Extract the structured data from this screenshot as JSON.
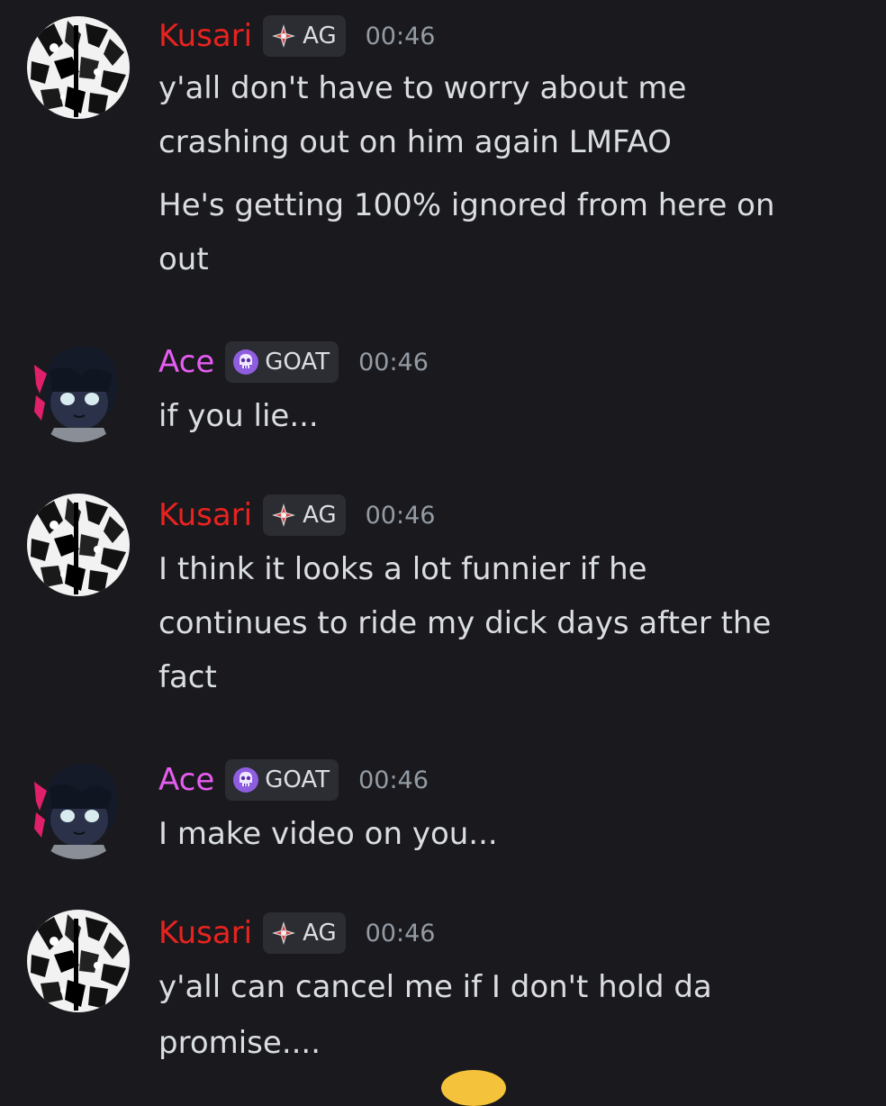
{
  "colors": {
    "background": "#1a1a1e",
    "kusari_name": "#e8231f",
    "ace_name": "#e75cf2",
    "message_text": "#dbdee1",
    "timestamp": "#949ba4",
    "tag_bg": "#2b2d33"
  },
  "messages": [
    {
      "author": "Kusari",
      "tag": "AG",
      "tag_icon": "crosshair-diamond-icon",
      "avatar": "kusari-avatar",
      "time": "00:46",
      "lines": [
        "y'all don't have to worry about me",
        "crashing out on him again LMFAO",
        "He's getting 100% ignored from here on",
        "out"
      ]
    },
    {
      "author": "Ace",
      "tag": "GOAT",
      "tag_icon": "skull-icon",
      "avatar": "ace-avatar",
      "time": "00:46",
      "lines": [
        "if you lie..."
      ]
    },
    {
      "author": "Kusari",
      "tag": "AG",
      "tag_icon": "crosshair-diamond-icon",
      "avatar": "kusari-avatar",
      "time": "00:46",
      "lines": [
        "I think it looks a lot funnier if he",
        "continues to ride my dick days after the",
        "fact"
      ]
    },
    {
      "author": "Ace",
      "tag": "GOAT",
      "tag_icon": "skull-icon",
      "avatar": "ace-avatar",
      "time": "00:46",
      "lines": [
        "I make video on you..."
      ]
    },
    {
      "author": "Kusari",
      "tag": "AG",
      "tag_icon": "crosshair-diamond-icon",
      "avatar": "kusari-avatar",
      "time": "00:46",
      "lines": [
        "y'all can cancel me if I don't hold da",
        "promise...."
      ]
    }
  ]
}
